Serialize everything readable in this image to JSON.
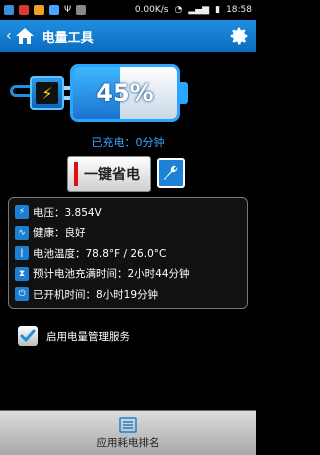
{
  "status_bar": {
    "speed": "0.00K/s",
    "time": "18:58"
  },
  "header": {
    "back_symbol": "‹",
    "title": "电量工具"
  },
  "battery": {
    "level_percent": 45,
    "level_text": "45%",
    "charged_text": "已充电：0分钟"
  },
  "actions": {
    "power_save_label": "一键省电"
  },
  "info": {
    "rows": [
      {
        "icon": "lightning-icon",
        "text": "电压：3.854V"
      },
      {
        "icon": "heartbeat-icon",
        "text": "健康：良好"
      },
      {
        "icon": "thermometer-icon",
        "text": "电池温度：78.8°F / 26.0°C"
      },
      {
        "icon": "hourglass-icon",
        "text": "预计电池充满时间：2小时44分钟"
      },
      {
        "icon": "power-icon",
        "text": "已开机时间：8小时19分钟"
      }
    ]
  },
  "settings": {
    "enable_service_label": "启用电量管理服务",
    "enable_service_checked": true
  },
  "bottom": {
    "ranking_label": "应用耗电排名"
  },
  "colors": {
    "accent": "#1d82d6",
    "charged_text": "#3aa3ff"
  }
}
